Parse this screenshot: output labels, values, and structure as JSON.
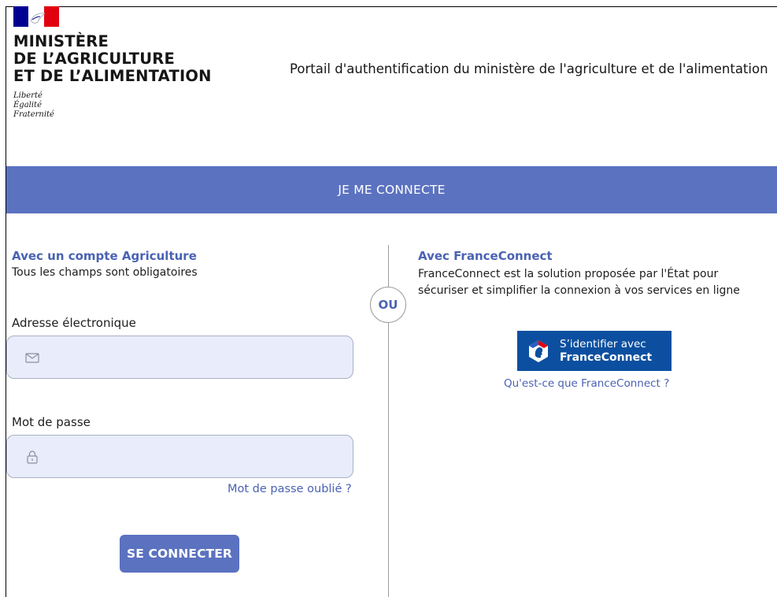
{
  "header": {
    "ministry_lines": [
      "MINISTÈRE",
      "DE L’AGRICULTURE",
      "ET DE L’ALIMENTATION"
    ],
    "devise_lines": [
      "Liberté",
      "Égalité",
      "Fraternité"
    ],
    "portal_title": "Portail d'authentification du ministère de l'agriculture et de l'alimentation"
  },
  "banner": {
    "label": "JE ME CONNECTE"
  },
  "agri_account": {
    "title": "Avec un compte Agriculture",
    "note": "Tous les champs sont obligatoires",
    "email_label": "Adresse électronique",
    "email_value": "",
    "password_label": "Mot de passe",
    "password_value": "",
    "forgot_label": "Mot de passe oublié ?",
    "submit_label": "SE CONNECTER"
  },
  "separator": {
    "label": "OU"
  },
  "franceconnect": {
    "title": "Avec FranceConnect",
    "description_lines": [
      "FranceConnect est la solution proposée par l'État pour",
      "sécuriser et simplifier la connexion à vos services en ligne"
    ],
    "button_line1": "S’identifier avec",
    "button_line2": "FranceConnect",
    "info_link": "Qu'est-ce que FranceConnect ?"
  },
  "colors": {
    "accent": "#5b72c0",
    "link": "#4a62b4",
    "input_bg": "#e8ecfb",
    "franceconnect_blue": "#0c4fa0",
    "flag_blue": "#000091",
    "flag_red": "#e1000f"
  },
  "icons": {
    "logo": "marianne-logo-icon",
    "email": "envelope-icon",
    "password": "padlock-icon",
    "franceconnect": "franceconnect-logo-icon"
  }
}
